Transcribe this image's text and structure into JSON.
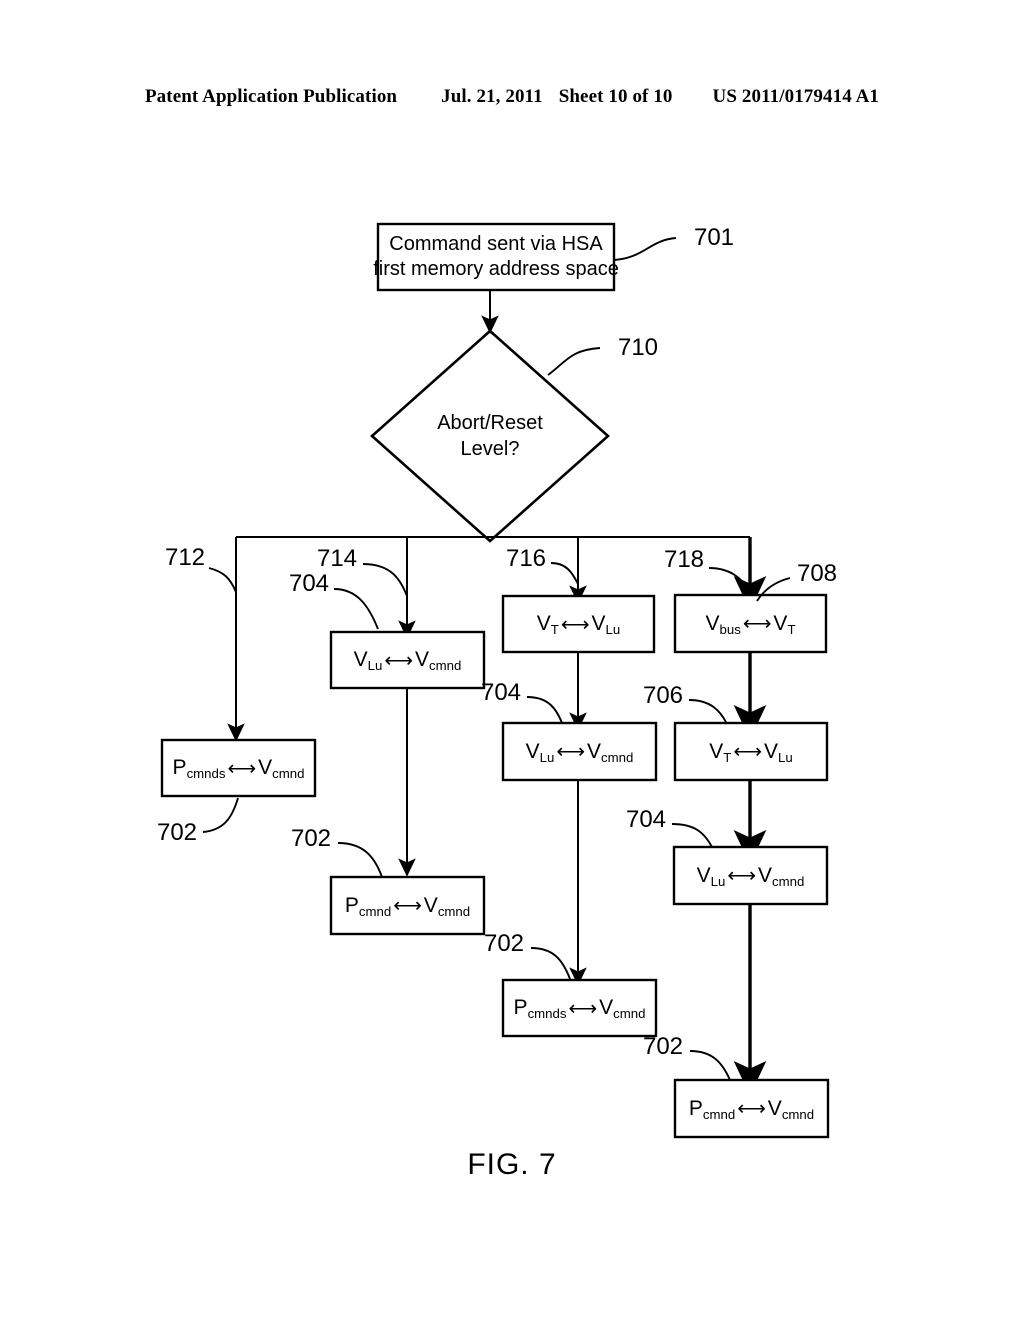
{
  "header": {
    "publication": "Patent Application Publication",
    "date": "Jul. 21, 2011",
    "sheet": "Sheet 10 of 10",
    "number": "US 2011/0179414 A1"
  },
  "figure": {
    "caption": "FIG. 7"
  },
  "flowchart": {
    "start": {
      "ref": "701",
      "line1": "Command sent via HSA",
      "line2": "first memory address space"
    },
    "decision": {
      "ref": "710",
      "line1": "Abort/Reset",
      "line2": "Level?"
    },
    "branch_refs": {
      "b712": "712",
      "b714": "714",
      "b716": "716",
      "b718": "718"
    },
    "nodes": [
      {
        "id": "n708",
        "ref": "708",
        "left": "V",
        "left_sub": "bus",
        "arrow": "⟷",
        "right": "V",
        "right_sub": "T"
      },
      {
        "id": "n716_vt",
        "ref": "",
        "left": "V",
        "left_sub": "T",
        "arrow": "⟷",
        "right": "V",
        "right_sub": "Lu"
      },
      {
        "id": "n706",
        "ref": "706",
        "left": "V",
        "left_sub": "T",
        "arrow": "⟷",
        "right": "V",
        "right_sub": "Lu"
      },
      {
        "id": "n704a",
        "ref": "704",
        "left": "V",
        "left_sub": "Lu",
        "arrow": "⟷",
        "right": "V",
        "right_sub": "cmnd"
      },
      {
        "id": "n704b",
        "ref": "704",
        "left": "V",
        "left_sub": "Lu",
        "arrow": "⟷",
        "right": "V",
        "right_sub": "cmnd"
      },
      {
        "id": "n704c",
        "ref": "704",
        "left": "V",
        "left_sub": "Lu",
        "arrow": "⟷",
        "right": "V",
        "right_sub": "cmnd"
      },
      {
        "id": "n702a",
        "ref": "702",
        "left": "P",
        "left_sub": "cmnds",
        "arrow": "⟷",
        "right": "V",
        "right_sub": "cmnd"
      },
      {
        "id": "n702b",
        "ref": "702",
        "left": "P",
        "left_sub": "cmnd",
        "arrow": "⟷",
        "right": "V",
        "right_sub": "cmnd"
      },
      {
        "id": "n702c",
        "ref": "702",
        "left": "P",
        "left_sub": "cmnds",
        "arrow": "⟷",
        "right": "V",
        "right_sub": "cmnd"
      },
      {
        "id": "n702d",
        "ref": "702",
        "left": "P",
        "left_sub": "cmnd",
        "arrow": "⟷",
        "right": "V",
        "right_sub": "cmnd"
      }
    ]
  },
  "colors": {
    "ink": "#000000",
    "paper": "#ffffff"
  }
}
